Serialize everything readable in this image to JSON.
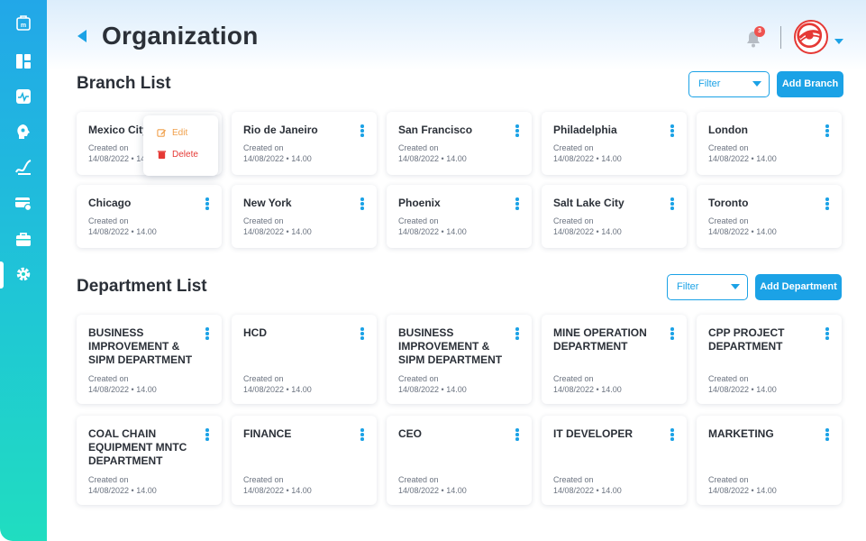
{
  "header": {
    "title": "Organization",
    "notification_count": "3"
  },
  "sidebar": {
    "items": [
      {
        "icon": "logo-icon"
      },
      {
        "icon": "dashboard-icon"
      },
      {
        "icon": "activity-icon"
      },
      {
        "icon": "brain-icon"
      },
      {
        "icon": "chart-icon"
      },
      {
        "icon": "card-settings-icon"
      },
      {
        "icon": "briefcase-icon"
      },
      {
        "icon": "gear-icon"
      }
    ],
    "active_index": 7
  },
  "branch": {
    "title": "Branch List",
    "filter_label": "Filter",
    "add_label": "Add Branch",
    "items": [
      {
        "name": "Mexico City",
        "created_label": "Created on",
        "date": "14/08/2022 • 14.00"
      },
      {
        "name": "Rio de Janeiro",
        "created_label": "Created on",
        "date": "14/08/2022 • 14.00"
      },
      {
        "name": "San Francisco",
        "created_label": "Created on",
        "date": "14/08/2022 • 14.00"
      },
      {
        "name": "Philadelphia",
        "created_label": "Created on",
        "date": "14/08/2022 • 14.00"
      },
      {
        "name": "London",
        "created_label": "Created on",
        "date": "14/08/2022 • 14.00"
      },
      {
        "name": "Chicago",
        "created_label": "Created on",
        "date": "14/08/2022 • 14.00"
      },
      {
        "name": "New York",
        "created_label": "Created on",
        "date": "14/08/2022 • 14.00"
      },
      {
        "name": "Phoenix",
        "created_label": "Created on",
        "date": "14/08/2022 • 14.00"
      },
      {
        "name": "Salt Lake City",
        "created_label": "Created on",
        "date": "14/08/2022 • 14.00"
      },
      {
        "name": "Toronto",
        "created_label": "Created on",
        "date": "14/08/2022 • 14.00"
      }
    ]
  },
  "context_menu": {
    "edit_label": "Edit",
    "delete_label": "Delete"
  },
  "department": {
    "title": "Department List",
    "filter_label": "Filter",
    "add_label": "Add Department",
    "items": [
      {
        "name": "BUSINESS IMPROVEMENT & SIPM DEPARTMENT",
        "created_label": "Created on",
        "date": "14/08/2022 • 14.00"
      },
      {
        "name": "HCD",
        "created_label": "Created on",
        "date": "14/08/2022 • 14.00"
      },
      {
        "name": "BUSINESS IMPROVEMENT & SIPM DEPARTMENT",
        "created_label": "Created on",
        "date": "14/08/2022 • 14.00"
      },
      {
        "name": "MINE OPERATION DEPARTMENT",
        "created_label": "Created on",
        "date": "14/08/2022 • 14.00"
      },
      {
        "name": "CPP PROJECT DEPARTMENT",
        "created_label": "Created on",
        "date": "14/08/2022 • 14.00"
      },
      {
        "name": "COAL CHAIN EQUIPMENT MNTC DEPARTMENT",
        "created_label": "Created on",
        "date": "14/08/2022 • 14.00"
      },
      {
        "name": "FINANCE",
        "created_label": "Created on",
        "date": "14/08/2022 • 14.00"
      },
      {
        "name": "CEO",
        "created_label": "Created on",
        "date": "14/08/2022 • 14.00"
      },
      {
        "name": "IT DEVELOPER",
        "created_label": "Created on",
        "date": "14/08/2022 • 14.00"
      },
      {
        "name": "MARKETING",
        "created_label": "Created on",
        "date": "14/08/2022 • 14.00"
      }
    ]
  },
  "colors": {
    "accent": "#1ba2e6",
    "edit": "#f0a04b",
    "delete": "#e53935"
  }
}
